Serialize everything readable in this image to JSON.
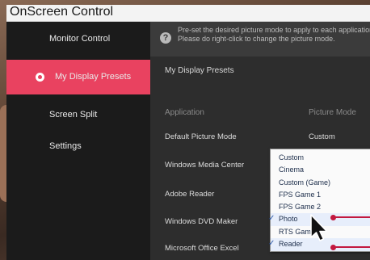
{
  "window": {
    "title": "OnScreen Control"
  },
  "sidebar": {
    "items": [
      {
        "label": "Monitor Control",
        "active": false
      },
      {
        "label": "My Display Presets",
        "active": true
      },
      {
        "label": "Screen Split",
        "active": false
      },
      {
        "label": "Settings",
        "active": false
      }
    ]
  },
  "info": {
    "line1": "Pre-set the desired picture mode to apply to each applications",
    "line2": "Please do right-click to change the picture mode."
  },
  "presets": {
    "title": "My Display Presets",
    "col_application": "Application",
    "col_picture_mode": "Picture Mode",
    "rows": [
      {
        "app": "Default Picture Mode",
        "mode": "Custom"
      },
      {
        "app": "Windows Media Center",
        "mode": ""
      },
      {
        "app": "Adobe Reader",
        "mode": ""
      },
      {
        "app": "Windows DVD Maker",
        "mode": ""
      },
      {
        "app": "Microsoft Office Excel",
        "mode": ""
      }
    ]
  },
  "dropdown": {
    "options": [
      {
        "label": "Custom",
        "checked": false
      },
      {
        "label": "Cinema",
        "checked": false
      },
      {
        "label": "Custom (Game)",
        "checked": false
      },
      {
        "label": "FPS Game 1",
        "checked": false
      },
      {
        "label": "FPS Game 2",
        "checked": false
      },
      {
        "label": "Photo",
        "checked": true
      },
      {
        "label": "RTS Game",
        "checked": false
      },
      {
        "label": "Reader",
        "checked": true
      }
    ],
    "check_glyph": "✓"
  },
  "colors": {
    "accent": "#e94260",
    "pointer": "#c2183f"
  }
}
